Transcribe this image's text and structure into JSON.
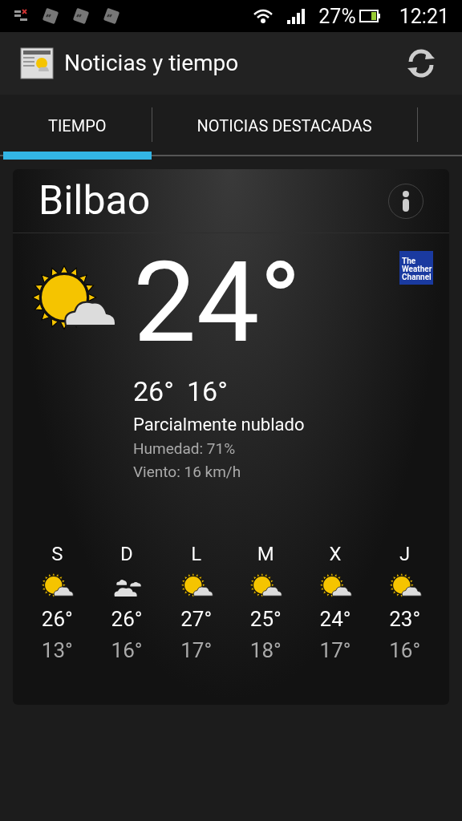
{
  "status_bar": {
    "battery": "27%",
    "time": "12:21"
  },
  "app_bar": {
    "title": "Noticias y tiempo"
  },
  "tabs": [
    {
      "label": "TIEMPO",
      "selected": true
    },
    {
      "label": "NOTICIAS DESTACADAS",
      "selected": false
    }
  ],
  "weather": {
    "city": "Bilbao",
    "provider_logo": "The Weather Channel",
    "kind": "partly_cloudy",
    "temperature": "24°",
    "high": "26°",
    "low": "16°",
    "condition": "Parcialmente nublado",
    "humidity": "Humedad: 71%",
    "wind": "Viento: 16 km/h",
    "forecast": [
      {
        "day": "S",
        "kind": "partly_cloudy",
        "high": "26°",
        "low": "13°"
      },
      {
        "day": "D",
        "kind": "cloudy",
        "high": "26°",
        "low": "16°"
      },
      {
        "day": "L",
        "kind": "partly_cloudy",
        "high": "27°",
        "low": "17°"
      },
      {
        "day": "M",
        "kind": "partly_cloudy",
        "high": "25°",
        "low": "18°"
      },
      {
        "day": "X",
        "kind": "partly_cloudy",
        "high": "24°",
        "low": "17°"
      },
      {
        "day": "J",
        "kind": "partly_cloudy",
        "high": "23°",
        "low": "16°"
      }
    ]
  }
}
